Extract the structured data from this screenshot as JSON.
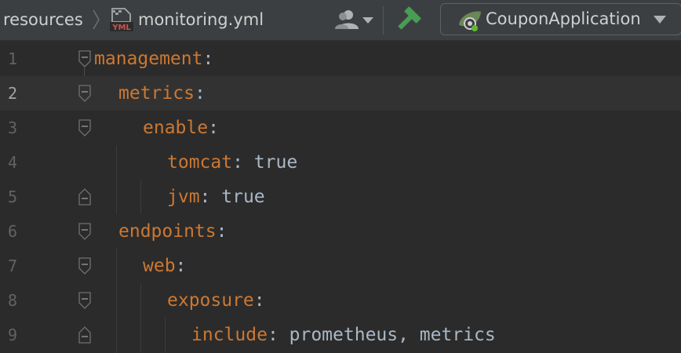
{
  "breadcrumb": {
    "folder": "resources",
    "file": "monitoring.yml",
    "file_icon_label": "YML"
  },
  "toolbar": {
    "run_config": "CouponApplication"
  },
  "icons": {
    "separator": "chevron-right-icon",
    "file": "yml-file-icon",
    "user": "user-icon",
    "build": "hammer-icon",
    "run_config": "spring-boot-icon",
    "dropdown": "triangle-down-icon"
  },
  "colors": {
    "key": "#cc7832",
    "value": "#a9b7c6",
    "editor_bg": "#2b2b2b",
    "current_line": "#323232",
    "build_icon": "#499c54"
  },
  "editor": {
    "current_line": 2,
    "lines": [
      {
        "num": "1",
        "key": "management",
        "colon": ":",
        "value": ""
      },
      {
        "num": "2",
        "key": "metrics",
        "colon": ":",
        "value": ""
      },
      {
        "num": "3",
        "key": "enable",
        "colon": ":",
        "value": ""
      },
      {
        "num": "4",
        "key": "tomcat",
        "colon": ":",
        "value": " true"
      },
      {
        "num": "5",
        "key": "jvm",
        "colon": ":",
        "value": " true"
      },
      {
        "num": "6",
        "key": "endpoints",
        "colon": ":",
        "value": ""
      },
      {
        "num": "7",
        "key": "web",
        "colon": ":",
        "value": ""
      },
      {
        "num": "8",
        "key": "exposure",
        "colon": ":",
        "value": ""
      },
      {
        "num": "9",
        "key": "include",
        "colon": ":",
        "value": " prometheus, metrics"
      }
    ]
  }
}
